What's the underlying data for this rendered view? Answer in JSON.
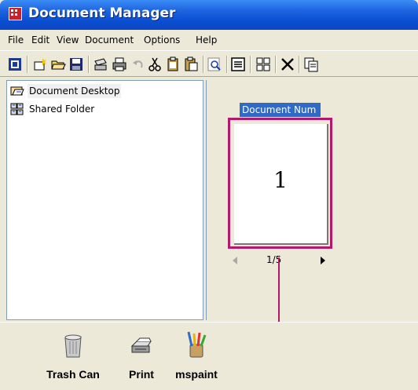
{
  "window": {
    "title": "Document Manager"
  },
  "menu": [
    "File",
    "Edit",
    "View",
    "Document",
    "Options",
    "Help"
  ],
  "toolbar": {
    "buttons": [
      "app-icon",
      "new-folder-icon",
      "open-folder-icon",
      "save-icon",
      "scan-icon",
      "print-icon",
      "undo-icon",
      "cut-icon",
      "copy-icon",
      "paste-icon",
      "zoom-icon",
      "list-view-icon",
      "thumbnail-view-icon",
      "delete-icon",
      "properties-icon"
    ]
  },
  "tree": {
    "items": [
      {
        "label": "Document Desktop",
        "icon": "desktop-icon",
        "selected": true
      },
      {
        "label": "Shared Folder",
        "icon": "shared-folder-icon",
        "selected": false
      }
    ]
  },
  "document": {
    "name": "Document Num",
    "page_number": "1",
    "pager": "1/5"
  },
  "shortcuts": [
    {
      "label": "Trash Can",
      "icon": "trash-can-icon"
    },
    {
      "label": "Print",
      "icon": "printer-icon"
    },
    {
      "label": "mspaint",
      "icon": "paint-brushes-icon"
    }
  ],
  "colors": {
    "titlebar": "#0b46c0",
    "highlight": "#b5176b",
    "selection": "#3169c6"
  }
}
